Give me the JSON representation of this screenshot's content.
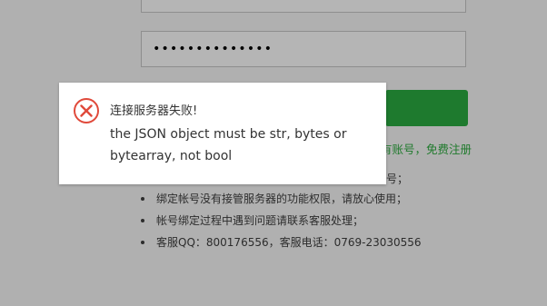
{
  "form": {
    "password_value": "••••••••••••••",
    "register_link": "有账号，免费注册"
  },
  "info": {
    "partial_item": "号；",
    "items": [
      "绑定帐号没有接管服务器的功能权限，请放心使用；",
      "帐号绑定过程中遇到问题请联系客服处理；",
      "客服QQ：800176556，客服电话：0769-23030556"
    ]
  },
  "dialog": {
    "icon": "error-circle-icon",
    "title": "连接服务器失败!",
    "detail": "the JSON object must be str, bytes or bytearray, not bool",
    "colors": {
      "icon": "#e0493a"
    }
  },
  "colors": {
    "overlay_bg": "#b0b0b0",
    "button_green": "#1e7a2e",
    "link_green": "#1f7a2c"
  }
}
